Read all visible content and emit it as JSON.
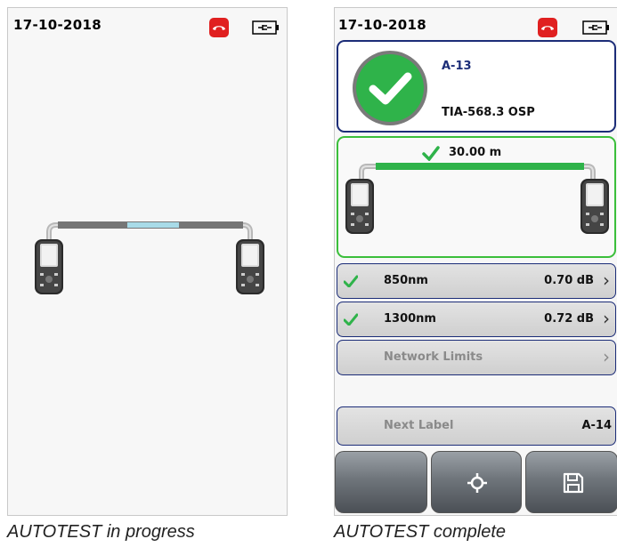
{
  "left_screen": {
    "date": "17-10-2018",
    "caption": "AUTOTEST in progress"
  },
  "right_screen": {
    "date": "17-10-2018",
    "caption": "AUTOTEST complete",
    "result": {
      "label_id": "A-13",
      "limit": "TIA-568.3 OSP"
    },
    "length": "30.00 m",
    "measurements": [
      {
        "wavelength": "850nm",
        "loss": "0.70 dB"
      },
      {
        "wavelength": "1300nm",
        "loss": "0.72 dB"
      }
    ],
    "network_limits_label": "Network Limits",
    "next_label": {
      "label": "Next Label",
      "value": "A-14"
    }
  },
  "icons": [
    "phone-icon",
    "battery-plug-icon",
    "check-icon",
    "crosshair-icon",
    "save-icon"
  ],
  "colors": {
    "pass_green": "#2fb34a",
    "border_blue": "#1c2d78",
    "phone_red": "#e02020",
    "progress_blue": "#a8dbe8"
  }
}
